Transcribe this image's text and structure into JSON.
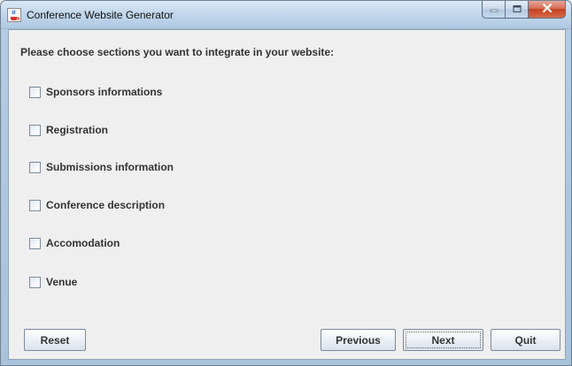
{
  "window": {
    "title": "Conference Website Generator",
    "icon": "java-cup-icon"
  },
  "window_controls": {
    "minimize": "minimize-icon",
    "maximize": "maximize-icon",
    "close": "close-icon"
  },
  "prompt": "Please choose sections you want to integrate in your website:",
  "sections": [
    {
      "label": "Sponsors informations",
      "checked": false
    },
    {
      "label": "Registration",
      "checked": false
    },
    {
      "label": "Submissions information",
      "checked": false
    },
    {
      "label": "Conference description",
      "checked": false
    },
    {
      "label": "Accomodation",
      "checked": false
    },
    {
      "label": "Venue",
      "checked": false
    }
  ],
  "buttons": {
    "reset": "Reset",
    "previous": "Previous",
    "next": "Next",
    "quit": "Quit"
  },
  "colors": {
    "close_button": "#c4401f",
    "client_background": "#efefef",
    "frame": "#b3cbe4"
  }
}
